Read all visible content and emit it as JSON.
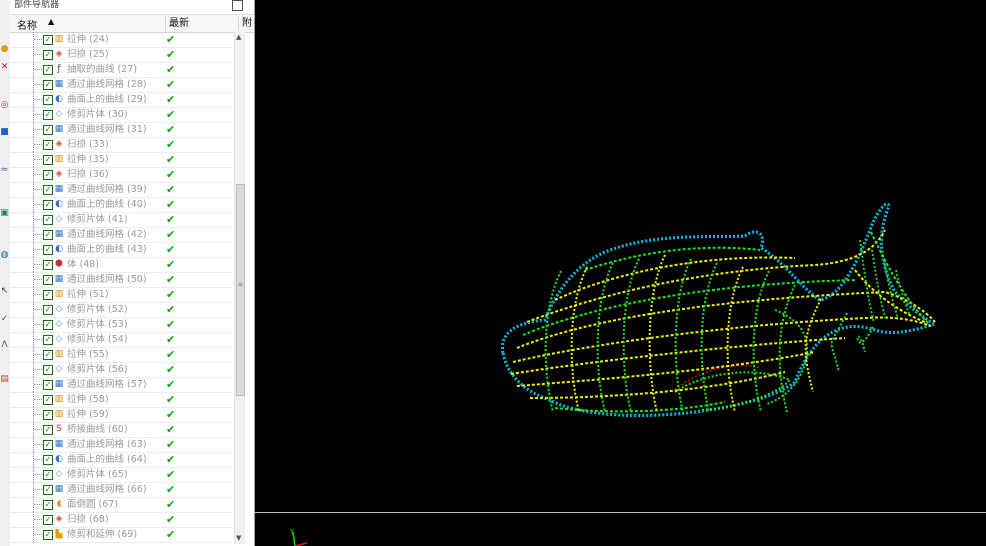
{
  "navigator": {
    "title": "部件导航器",
    "columns": {
      "name": "名称",
      "latest": "最新",
      "extra": "附"
    },
    "items": [
      {
        "label": "拉伸 (24)",
        "icon": "extrude-icon",
        "color": "#e08a00"
      },
      {
        "label": "扫掠 (25)",
        "icon": "swept-icon",
        "color": "#d24b3c"
      },
      {
        "label": "抽取的曲线 (27)",
        "icon": "extract-curve-icon",
        "color": "#444444"
      },
      {
        "label": "通过曲线网格 (28)",
        "icon": "mesh-surface-icon",
        "color": "#2f78c8"
      },
      {
        "label": "曲面上的曲线 (29)",
        "icon": "curve-on-surface-icon",
        "color": "#3a6cc0"
      },
      {
        "label": "修剪片体 (30)",
        "icon": "trim-sheet-icon",
        "color": "#5a8ad8"
      },
      {
        "label": "通过曲线网格 (31)",
        "icon": "mesh-surface-icon",
        "color": "#2f78c8"
      },
      {
        "label": "扫掠 (33)",
        "icon": "swept-icon",
        "color": "#d24b3c"
      },
      {
        "label": "拉伸 (35)",
        "icon": "extrude-icon",
        "color": "#e08a00"
      },
      {
        "label": "扫掠 (36)",
        "icon": "swept-icon",
        "color": "#d24b3c"
      },
      {
        "label": "通过曲线网格 (39)",
        "icon": "mesh-surface-icon",
        "color": "#2f78c8"
      },
      {
        "label": "曲面上的曲线 (40)",
        "icon": "curve-on-surface-icon",
        "color": "#3a6cc0"
      },
      {
        "label": "修剪片体 (41)",
        "icon": "trim-sheet-icon",
        "color": "#5a8ad8"
      },
      {
        "label": "通过曲线网格 (42)",
        "icon": "mesh-surface-icon",
        "color": "#2f78c8"
      },
      {
        "label": "曲面上的曲线 (43)",
        "icon": "curve-on-surface-icon",
        "color": "#3a6cc0"
      },
      {
        "label": "体 (48)",
        "icon": "body-icon",
        "color": "#c03030"
      },
      {
        "label": "通过曲线网格 (50)",
        "icon": "mesh-surface-icon",
        "color": "#2f78c8"
      },
      {
        "label": "拉伸 (51)",
        "icon": "extrude-icon",
        "color": "#e08a00"
      },
      {
        "label": "修剪片体 (52)",
        "icon": "trim-sheet-icon",
        "color": "#5a8ad8"
      },
      {
        "label": "修剪片体 (53)",
        "icon": "trim-sheet-icon",
        "color": "#5a8ad8"
      },
      {
        "label": "修剪片体 (54)",
        "icon": "trim-sheet-icon",
        "color": "#5a8ad8"
      },
      {
        "label": "拉伸 (55)",
        "icon": "extrude-icon",
        "color": "#e08a00"
      },
      {
        "label": "修剪片体 (56)",
        "icon": "trim-sheet-icon",
        "color": "#5a8ad8"
      },
      {
        "label": "通过曲线网格 (57)",
        "icon": "mesh-surface-icon",
        "color": "#2f78c8"
      },
      {
        "label": "拉伸 (58)",
        "icon": "extrude-icon",
        "color": "#e08a00"
      },
      {
        "label": "拉伸 (59)",
        "icon": "extrude-icon",
        "color": "#e08a00"
      },
      {
        "label": "桥接曲线 (60)",
        "icon": "bridge-curve-icon",
        "color": "#b03030"
      },
      {
        "label": "通过曲线网格 (63)",
        "icon": "mesh-surface-icon",
        "color": "#2f78c8"
      },
      {
        "label": "曲面上的曲线 (64)",
        "icon": "curve-on-surface-icon",
        "color": "#3a6cc0"
      },
      {
        "label": "修剪片体 (65)",
        "icon": "trim-sheet-icon",
        "color": "#5a8ad8"
      },
      {
        "label": "通过曲线网格 (66)",
        "icon": "mesh-surface-icon",
        "color": "#2f78c8"
      },
      {
        "label": "面倒圆 (67)",
        "icon": "face-blend-icon",
        "color": "#d89020"
      },
      {
        "label": "扫掠 (68)",
        "icon": "swept-icon",
        "color": "#d24b3c"
      },
      {
        "label": "修剪和延伸 (69)",
        "icon": "trim-extend-icon",
        "color": "#e0a000"
      }
    ],
    "status_check": "✔"
  },
  "viewport": {
    "background": "#000000",
    "model": "fish-wireframe-surface"
  },
  "colors": {
    "mesh_green": "#22e01e",
    "mesh_yellow": "#f2f200",
    "mesh_cyan": "#00d8d8",
    "mesh_blue": "#1e50ff",
    "mesh_red": "#d01010"
  }
}
